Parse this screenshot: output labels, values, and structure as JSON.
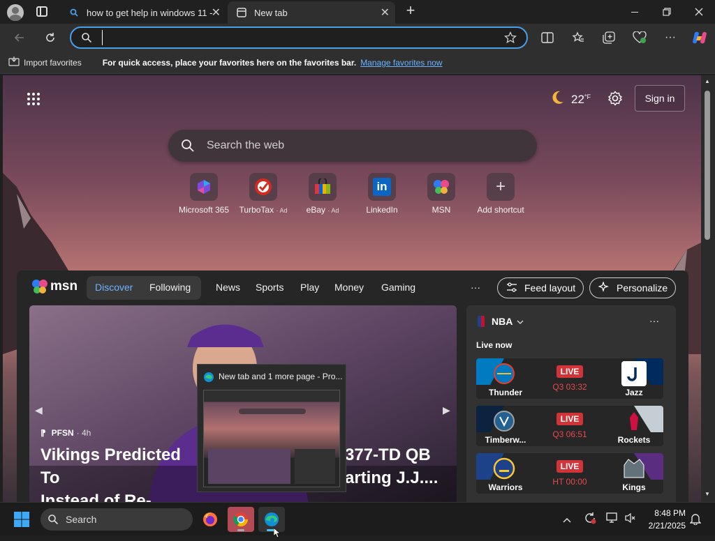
{
  "tabs": [
    {
      "title": "how to get help in windows 11 - ",
      "active": false
    },
    {
      "title": "New tab",
      "active": true
    }
  ],
  "address": {
    "value": "",
    "placeholder": ""
  },
  "favorites_bar": {
    "import_label": "Import favorites",
    "message": "For quick access, place your favorites here on the favorites bar.",
    "manage_link": "Manage favorites now"
  },
  "newtab": {
    "weather_temp": "22",
    "weather_unit": "°F",
    "sign_in": "Sign in",
    "search_placeholder": "Search the web",
    "shortcuts": [
      {
        "label": "Microsoft 365",
        "ad": ""
      },
      {
        "label": "TurboTax",
        "ad": "· Ad"
      },
      {
        "label": "eBay",
        "ad": "· Ad"
      },
      {
        "label": "LinkedIn",
        "ad": ""
      },
      {
        "label": "MSN",
        "ad": ""
      },
      {
        "label": "Add shortcut",
        "ad": ""
      }
    ]
  },
  "feed": {
    "brand": "msn",
    "tabs": [
      "Discover",
      "Following"
    ],
    "nav": [
      "News",
      "Sports",
      "Play",
      "Money",
      "Gaming"
    ],
    "more": "···",
    "feed_layout": "Feed layout",
    "personalize": "Personalize",
    "hero": {
      "source": "PFSN",
      "age": "· 4h",
      "headline_line1": "Vikings Predicted To",
      "headline_line2": "Instead of Re-Signin",
      "headline_tail1": "377-TD QB",
      "headline_tail2": "arting J.J...."
    },
    "nba": {
      "title": "NBA",
      "live_now": "Live now",
      "more": "···",
      "games": [
        {
          "home": "Thunder",
          "away": "Jazz",
          "status": "LIVE",
          "clock": "Q3 03:32"
        },
        {
          "home": "Timberw...",
          "away": "Rockets",
          "status": "LIVE",
          "clock": "Q3 06:51"
        },
        {
          "home": "Warriors",
          "away": "Kings",
          "status": "LIVE",
          "clock": "HT 00:00"
        }
      ]
    }
  },
  "preview": {
    "title": "New tab and 1 more page - Pro..."
  },
  "taskbar": {
    "search_label": "Search",
    "time": "8:48 PM",
    "date": "2/21/2025"
  },
  "colors": {
    "accent": "#4a9fea",
    "live": "#d13438",
    "link": "#6cb4ff"
  }
}
